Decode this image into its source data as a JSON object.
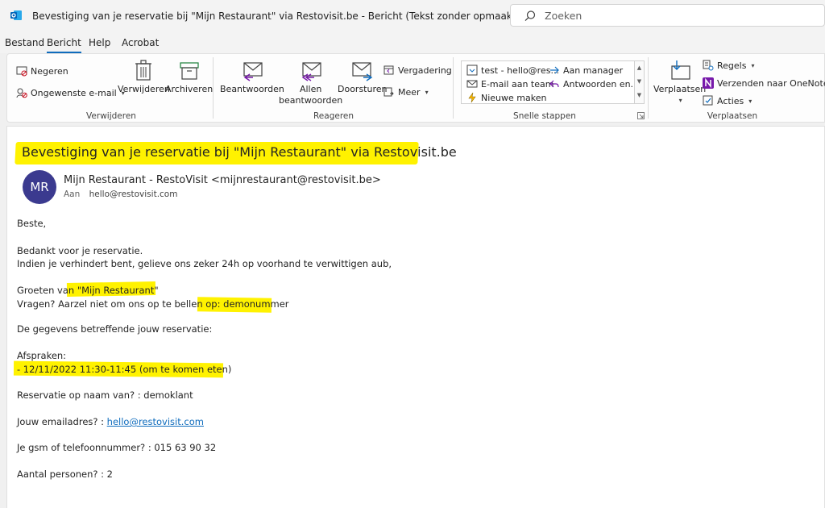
{
  "window": {
    "title": "Bevestiging van je reservatie bij \"Mijn Restaurant\" via Restovisit.be  -  Bericht (Tekst zonder opmaak)",
    "search_placeholder": "Zoeken"
  },
  "menu": {
    "tabs": [
      "Bestand",
      "Bericht",
      "Help",
      "Acrobat"
    ],
    "active": "Bericht"
  },
  "ribbon": {
    "verwijderen": {
      "label": "Verwijderen",
      "negeren": "Negeren",
      "ongewenste": "Ongewenste e-mail",
      "verwijderen_btn": "Verwijderen",
      "archiveren": "Archiveren"
    },
    "reageren": {
      "label": "Reageren",
      "beantwoorden": "Beantwoorden",
      "allen_1": "Allen",
      "allen_2": "beantwoorden",
      "doorsturen": "Doorsturen",
      "vergadering": "Vergadering",
      "meer": "Meer"
    },
    "snelle_stappen": {
      "label": "Snelle stappen",
      "test": "test - hello@res...",
      "email_team": "E-mail aan team",
      "nieuwe": "Nieuwe maken",
      "aan_manager": "Aan manager",
      "antwoorden": "Antwoorden en..."
    },
    "verplaatsen": {
      "label": "Verplaatsen",
      "verplaatsen_btn": "Verplaatsen",
      "regels": "Regels",
      "onenote": "Verzenden naar OneNote",
      "acties": "Acties"
    }
  },
  "message": {
    "subject": "Bevestiging van je reservatie bij \"Mijn Restaurant\" via Restovisit.be",
    "avatar_initials": "MR",
    "sender": "Mijn Restaurant - RestoVisit <mijnrestaurant@restovisit.be>",
    "to_label": "Aan",
    "to": "hello@restovisit.com",
    "body": {
      "greeting": "Beste,",
      "thanks": "Bedankt voor je reservatie.",
      "notice": "Indien je verhindert bent, gelieve ons zeker 24h op voorhand te verwittigen aub,",
      "groeten_prefix": "Groeten van ",
      "restaurant": "\"Mijn Restaurant\"",
      "vragen_prefix": "Vragen? Aarzel niet om ons op te bellen op: ",
      "phone_demo": "demonummer",
      "details": "De gegevens betreffende jouw reservatie:",
      "afspraken": "Afspraken:",
      "appointment": "- 12/11/2022 11:30-11:45 (om te komen eten)",
      "naam": "Reservatie op naam van? : demoklant",
      "email_prefix": "Jouw emailadres? : ",
      "email": "hello@restovisit.com",
      "gsm": "Je gsm of telefoonnummer? : 015 63 90 32",
      "personen": "Aantal personen? : 2"
    }
  },
  "colors": {
    "accent": "#0f6cbd",
    "highlight": "#fff200",
    "avatar": "#3b3a8f"
  }
}
